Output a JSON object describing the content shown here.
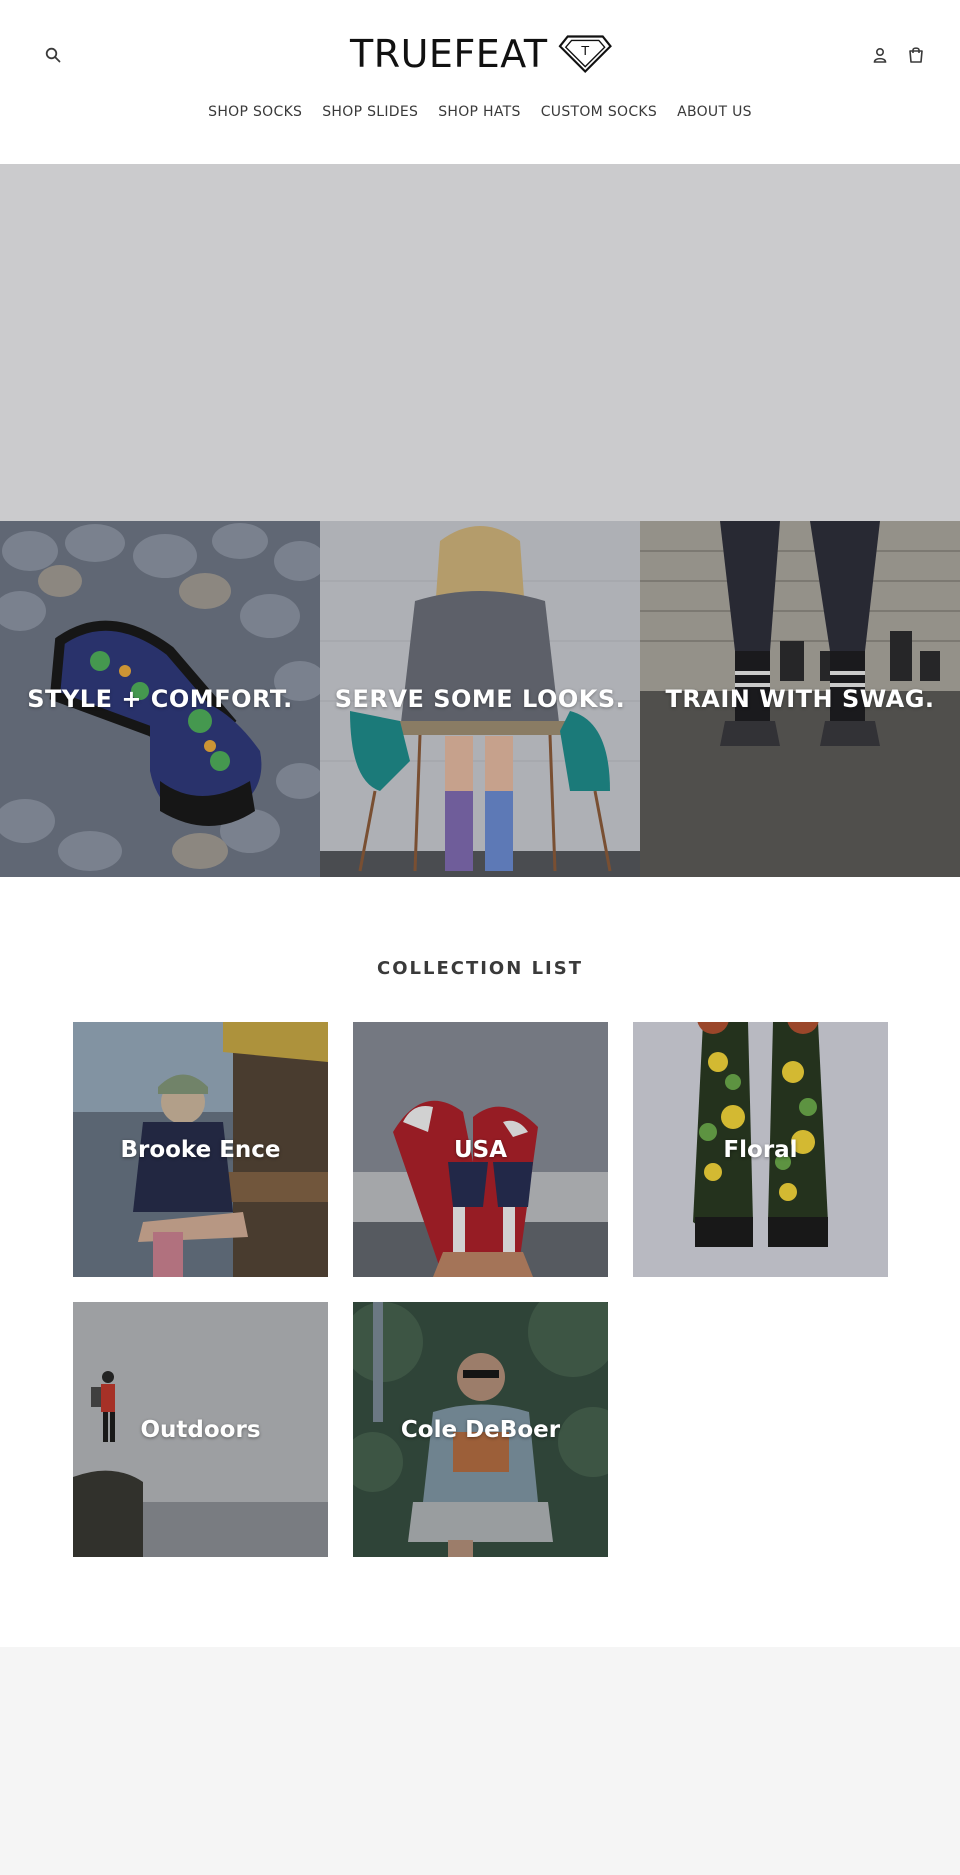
{
  "header": {
    "logo_text": "TRUEFEAT",
    "logo_mark": "T",
    "icons": {
      "search": "search-icon",
      "account": "user-icon",
      "cart": "cart-icon"
    },
    "nav": [
      {
        "label": "SHOP SOCKS"
      },
      {
        "label": "SHOP SLIDES"
      },
      {
        "label": "SHOP HATS"
      },
      {
        "label": "CUSTOM SOCKS"
      },
      {
        "label": "ABOUT US"
      }
    ]
  },
  "promos": [
    {
      "title": "STYLE + COMFORT."
    },
    {
      "title": "SERVE SOME LOOKS."
    },
    {
      "title": "TRAIN WITH SWAG."
    }
  ],
  "collection": {
    "heading": "COLLECTION LIST",
    "items": [
      {
        "title": "Brooke Ence"
      },
      {
        "title": "USA"
      },
      {
        "title": "Floral"
      },
      {
        "title": "Outdoors"
      },
      {
        "title": "Cole DeBoer"
      }
    ]
  },
  "colors": {
    "text": "#3a3a3a",
    "hero_placeholder": "#cbcbcd",
    "footer_bg": "#f5f5f5"
  }
}
